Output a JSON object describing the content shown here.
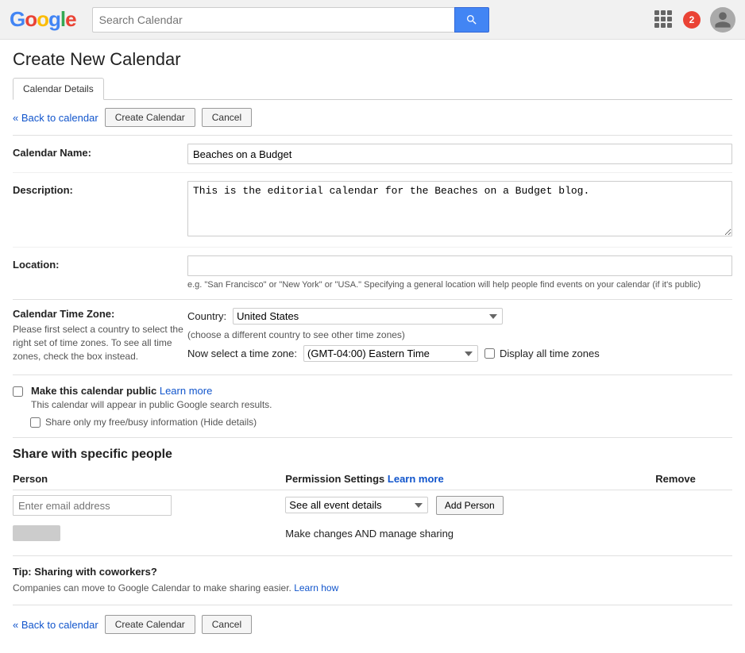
{
  "header": {
    "logo": "Google",
    "search_placeholder": "Search Calendar",
    "search_button_label": "Search",
    "notification_count": "2"
  },
  "page": {
    "title": "Create New Calendar",
    "tab_label": "Calendar Details",
    "back_link": "« Back to calendar",
    "create_button": "Create Calendar",
    "cancel_button": "Cancel"
  },
  "form": {
    "calendar_name_label": "Calendar Name:",
    "calendar_name_value": "Beaches on a Budget",
    "description_label": "Description:",
    "description_value": "This is the editorial calendar for the Beaches on a Budget blog.",
    "location_label": "Location:",
    "location_value": "",
    "location_hint": "e.g. \"San Francisco\" or \"New York\" or \"USA.\" Specifying a general location will help people find events on your calendar (if it's public)",
    "timezone_label": "Calendar Time Zone:",
    "timezone_hint": "Please first select a country to select the right set of time zones. To see all time zones, check the box instead.",
    "country_label": "Country:",
    "country_value": "United States",
    "country_hint": "(choose a different country to see other time zones)",
    "timezone_now_label": "Now select a time zone:",
    "timezone_value": "(GMT-04:00) Eastern Time",
    "display_all_tz_label": "Display all time zones"
  },
  "public": {
    "checkbox_label": "Make this calendar public",
    "learn_more_link": "Learn more",
    "hint": "This calendar will appear in public Google search results.",
    "share_free_busy_label": "Share only my free/busy information (Hide details)"
  },
  "share": {
    "title": "Share with specific people",
    "col_person": "Person",
    "col_permission": "Permission Settings",
    "permission_learn_more": "Learn more",
    "col_remove": "Remove",
    "email_placeholder": "Enter email address",
    "permission_default": "See all event details",
    "add_person_button": "Add Person",
    "person_permission": "Make changes AND manage sharing"
  },
  "tip": {
    "title": "Tip: Sharing with coworkers?",
    "text": "Companies can move to Google Calendar to make sharing easier.",
    "learn_how_link": "Learn how"
  }
}
